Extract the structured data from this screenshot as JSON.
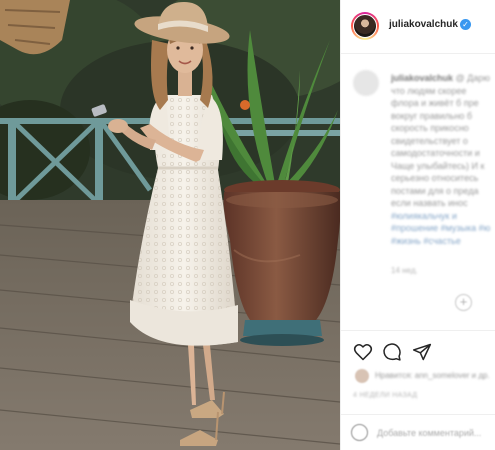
{
  "post": {
    "photo_alt": "Woman in white lace dress and straw hat standing on a wooden deck"
  },
  "header": {
    "username": "juliakovalchuk",
    "verified_glyph": "✓"
  },
  "caption": {
    "user": "juliakovalchuk",
    "lines": [
      "@ Дарю",
      "что людям скорее",
      "флора и живёт б пре",
      "вокруг правильно б",
      "скорость прикосно",
      "свидетельствует о",
      "самодостаточности и",
      "Чаще улыбайтесь) И к",
      "серьезно относитесь",
      "постами для о преда",
      "если назвать инос"
    ],
    "hashtags": [
      "#юлиякальчук и",
      "#прошение #музыка #ю",
      "#жизнь #счастье"
    ]
  },
  "meta": {
    "time_ago": "14 нед.",
    "likes_text": "Нравится: ann_somelover и др.",
    "date": "4 НЕДЕЛИ НАЗАД"
  },
  "comment": {
    "placeholder": "Добавьте комментарий..."
  },
  "icons": {
    "like": "heart-icon",
    "comment": "comment-bubble-icon",
    "share": "paper-plane-icon",
    "emoji": "smiley-icon",
    "verified": "verified-badge-icon",
    "more": "plus-circle-icon"
  },
  "colors": {
    "verified_blue": "#3897f0",
    "text_dark": "#262626",
    "divider": "#efefef",
    "dress_white": "#f3eee6",
    "hat_tan": "#c9a983",
    "pot_terracotta": "#7a4a36",
    "deck_wood": "#6f655a"
  }
}
